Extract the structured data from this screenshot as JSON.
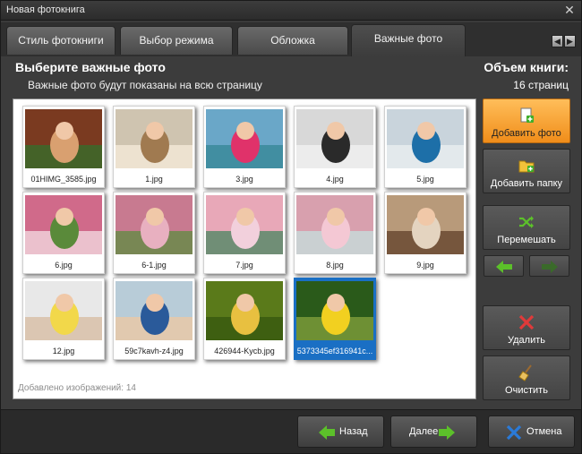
{
  "window": {
    "title": "Новая фотокнига"
  },
  "tabs": [
    {
      "label": "Стиль фотокниги"
    },
    {
      "label": "Выбор режима"
    },
    {
      "label": "Обложка"
    },
    {
      "label": "Важные фото",
      "active": true
    }
  ],
  "header": {
    "title": "Выберите важные фото",
    "subtitle": "Важные фото будут показаны на всю страницу"
  },
  "volume": {
    "title": "Объем книги:",
    "value": "16 страниц"
  },
  "photos": [
    {
      "caption": "01HIMG_3585.jpg",
      "palette": [
        "#7a3a20",
        "#d9a070",
        "#3b6a2a"
      ]
    },
    {
      "caption": "1.jpg",
      "palette": [
        "#cfc4b0",
        "#a07a50",
        "#f2e8d6"
      ]
    },
    {
      "caption": "3.jpg",
      "palette": [
        "#6aa7c8",
        "#e0326a",
        "#3a8a9a"
      ]
    },
    {
      "caption": "4.jpg",
      "palette": [
        "#d8d8d8",
        "#2a2a2a",
        "#f0f0f0"
      ]
    },
    {
      "caption": "5.jpg",
      "palette": [
        "#c9d4dc",
        "#1d6fa8",
        "#e8ecee"
      ]
    },
    {
      "caption": "6.jpg",
      "palette": [
        "#d06a8a",
        "#5a8a3a",
        "#f0d0d8"
      ]
    },
    {
      "caption": "6-1.jpg",
      "palette": [
        "#c87a90",
        "#e8b0c0",
        "#6a8a4a"
      ]
    },
    {
      "caption": "7.jpg",
      "palette": [
        "#e8a8b8",
        "#f2d0dc",
        "#5a8a6a"
      ]
    },
    {
      "caption": "8.jpg",
      "palette": [
        "#d8a0ae",
        "#f4c8d4",
        "#c8d8d8"
      ]
    },
    {
      "caption": "9.jpg",
      "palette": [
        "#b89a7a",
        "#e4d4c0",
        "#6a4a32"
      ]
    },
    {
      "caption": "12.jpg",
      "palette": [
        "#e8e8e8",
        "#f2d84a",
        "#d8c0a8"
      ]
    },
    {
      "caption": "59c7kavh-z4.jpg",
      "palette": [
        "#b8ccd8",
        "#2a5a9a",
        "#e8c8a8"
      ]
    },
    {
      "caption": "426944-Kycb.jpg",
      "palette": [
        "#5a7a1a",
        "#e8c040",
        "#3a5a10"
      ]
    },
    {
      "caption": "5373345ef316941c...",
      "palette": [
        "#2a5a1a",
        "#f2d020",
        "#7a9a3a"
      ],
      "selected": true
    }
  ],
  "added_text": "Добавлено изображений: 14",
  "side_buttons": {
    "add_photo": "Добавить фото",
    "add_folder": "Добавить папку",
    "shuffle": "Перемешать",
    "delete": "Удалить",
    "clear": "Очистить"
  },
  "footer": {
    "back": "Назад",
    "next": "Далее",
    "cancel": "Отмена"
  },
  "colors": {
    "accent": "#f08d1a",
    "selection": "#1a6fc4",
    "green_arrow": "#5cc02a",
    "red_x": "#e03a3a",
    "blue_x": "#2a7ad8"
  }
}
